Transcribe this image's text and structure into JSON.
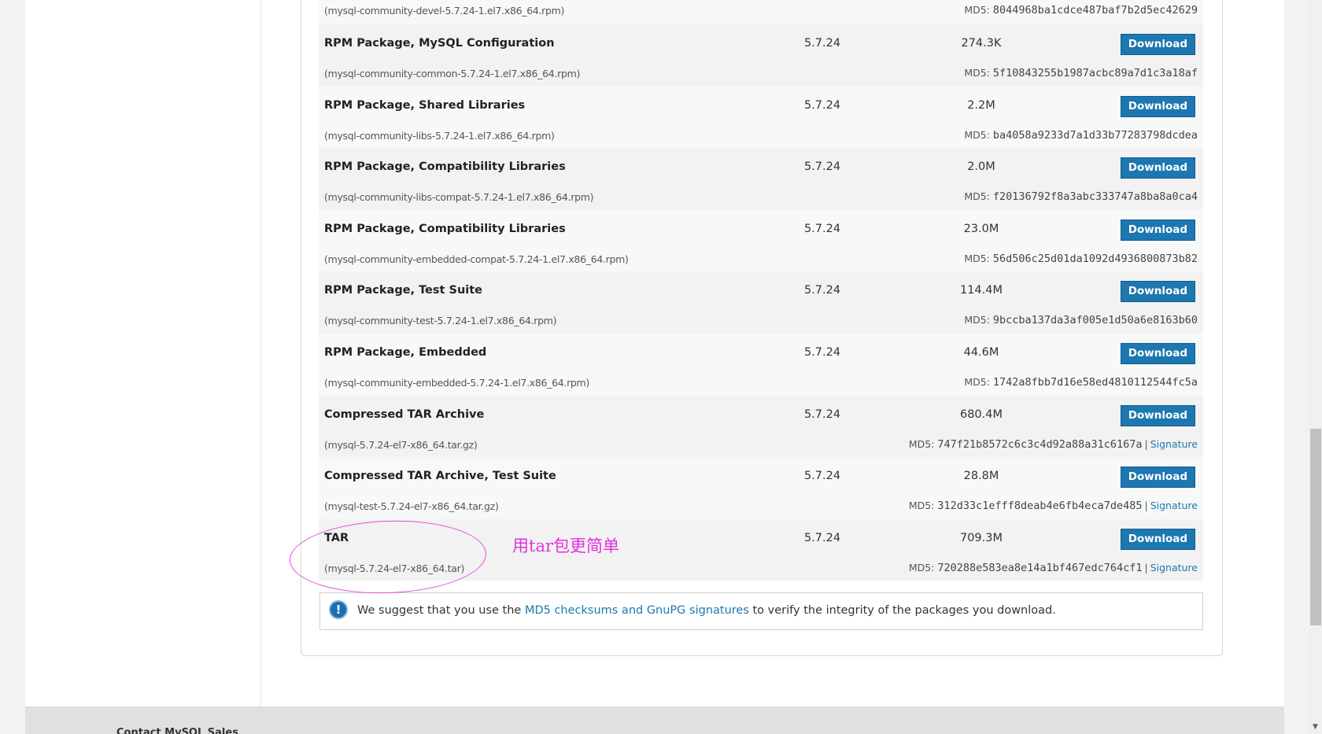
{
  "packages": {
    "first": {
      "file": "(mysql-community-devel-5.7.24-1.el7.x86_64.rpm)",
      "md5_label": "MD5:",
      "md5": "8044968ba1cdce487baf7b2d5ec42629"
    },
    "rows": [
      {
        "name": "RPM Package, MySQL Configuration",
        "version": "5.7.24",
        "size": "274.3K",
        "download": "Download",
        "file": "(mysql-community-common-5.7.24-1.el7.x86_64.rpm)",
        "md5_label": "MD5:",
        "md5": "5f10843255b1987acbc89a7d1c3a18af"
      },
      {
        "name": "RPM Package, Shared Libraries",
        "version": "5.7.24",
        "size": "2.2M",
        "download": "Download",
        "file": "(mysql-community-libs-5.7.24-1.el7.x86_64.rpm)",
        "md5_label": "MD5:",
        "md5": "ba4058a9233d7a1d33b77283798dcdea"
      },
      {
        "name": "RPM Package, Compatibility Libraries",
        "version": "5.7.24",
        "size": "2.0M",
        "download": "Download",
        "file": "(mysql-community-libs-compat-5.7.24-1.el7.x86_64.rpm)",
        "md5_label": "MD5:",
        "md5": "f20136792f8a3abc333747a8ba8a0ca4"
      },
      {
        "name": "RPM Package, Compatibility Libraries",
        "version": "5.7.24",
        "size": "23.0M",
        "download": "Download",
        "file": "(mysql-community-embedded-compat-5.7.24-1.el7.x86_64.rpm)",
        "md5_label": "MD5:",
        "md5": "56d506c25d01da1092d4936800873b82"
      },
      {
        "name": "RPM Package, Test Suite",
        "version": "5.7.24",
        "size": "114.4M",
        "download": "Download",
        "file": "(mysql-community-test-5.7.24-1.el7.x86_64.rpm)",
        "md5_label": "MD5:",
        "md5": "9bccba137da3af005e1d50a6e8163b60"
      },
      {
        "name": "RPM Package, Embedded",
        "version": "5.7.24",
        "size": "44.6M",
        "download": "Download",
        "file": "(mysql-community-embedded-5.7.24-1.el7.x86_64.rpm)",
        "md5_label": "MD5:",
        "md5": "1742a8fbb7d16e58ed4810112544fc5a"
      },
      {
        "name": "Compressed TAR Archive",
        "version": "5.7.24",
        "size": "680.4M",
        "download": "Download",
        "file": "(mysql-5.7.24-el7-x86_64.tar.gz)",
        "md5_label": "MD5:",
        "md5": "747f21b8572c6c3c4d92a88a31c6167a",
        "separator": "|",
        "signature": "Signature"
      },
      {
        "name": "Compressed TAR Archive, Test Suite",
        "version": "5.7.24",
        "size": "28.8M",
        "download": "Download",
        "file": "(mysql-test-5.7.24-el7-x86_64.tar.gz)",
        "md5_label": "MD5:",
        "md5": "312d33c1efff8deab4e6fb4eca7de485",
        "separator": "|",
        "signature": "Signature"
      },
      {
        "name": "TAR",
        "version": "5.7.24",
        "size": "709.3M",
        "download": "Download",
        "file": "(mysql-5.7.24-el7-x86_64.tar)",
        "md5_label": "MD5:",
        "md5": "720288e583ea8e14a1bf467edc764cf1",
        "separator": "|",
        "signature": "Signature"
      }
    ]
  },
  "integrity_note": {
    "icon": "info-icon",
    "icon_glyph": "!",
    "text_before": "We suggest that you use the ",
    "link": "MD5 checksums and GnuPG signatures",
    "text_after": " to verify the integrity of the packages you download."
  },
  "annotation": {
    "text": "用tar包更简单",
    "color": "#e030e0"
  },
  "footer": {
    "title": "Contact MySQL Sales"
  },
  "colors": {
    "download_button": "#1d77b0",
    "link": "#1d77b0"
  }
}
